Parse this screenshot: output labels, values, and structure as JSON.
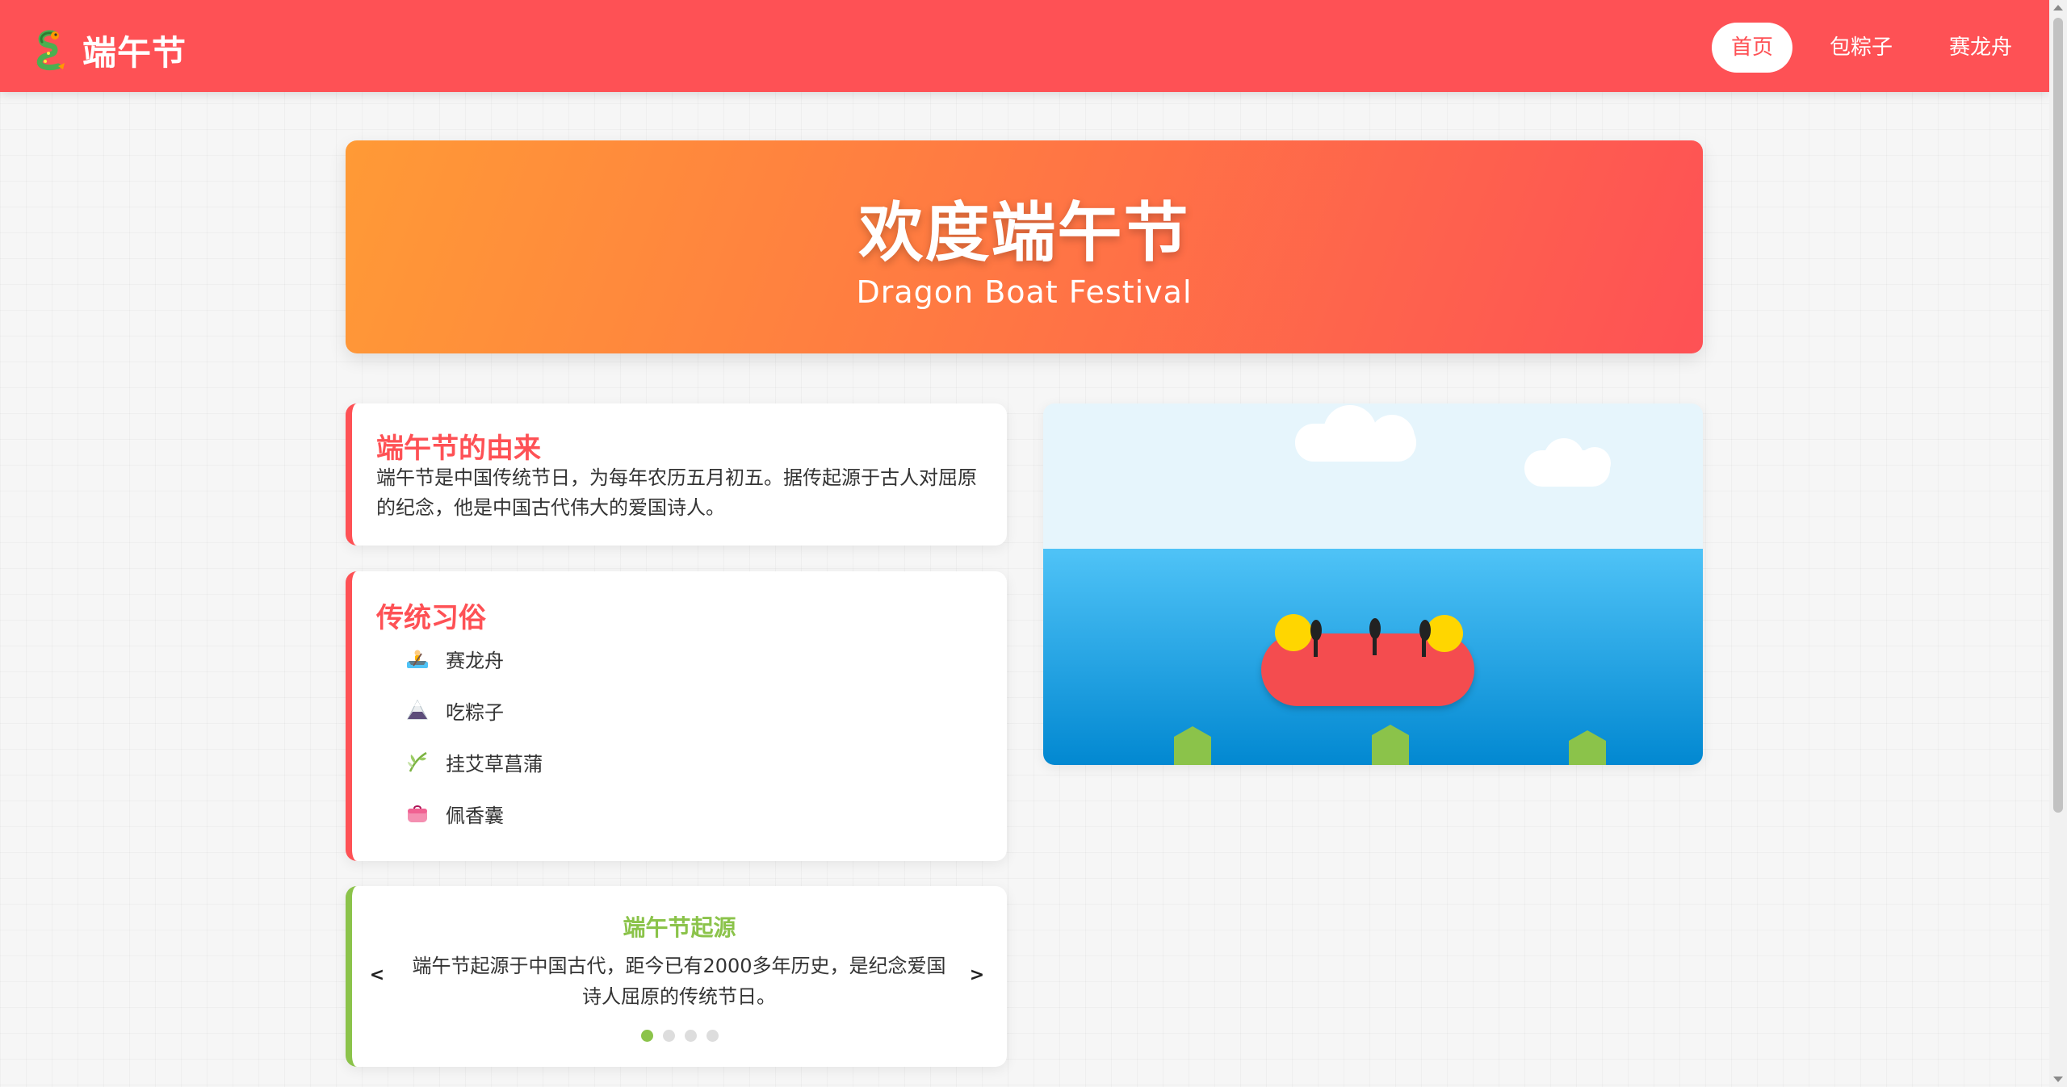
{
  "app": {
    "brand_title": "端午节",
    "brand_logo_icon": "dragon-icon"
  },
  "nav": {
    "items": [
      {
        "label": "首页",
        "active": true
      },
      {
        "label": "包粽子",
        "active": false
      },
      {
        "label": "赛龙舟",
        "active": false
      }
    ]
  },
  "hero": {
    "title": "欢度端午节",
    "subtitle": "Dragon Boat Festival"
  },
  "origin_card": {
    "title": "端午节的由来",
    "text": "端午节是中国传统节日，为每年农历五月初五。据传起源于古人对屈原的纪念，他是中国古代伟大的爱国诗人。"
  },
  "customs_card": {
    "title": "传统习俗",
    "items": [
      {
        "icon": "rowing-boat-icon",
        "label": "赛龙舟"
      },
      {
        "icon": "rice-dumpling-icon",
        "label": "吃粽子"
      },
      {
        "icon": "herb-icon",
        "label": "挂艾草菖蒲"
      },
      {
        "icon": "sachet-icon",
        "label": "佩香囊"
      }
    ]
  },
  "slider_card": {
    "title": "端午节起源",
    "text": "端午节起源于中国古代，距今已有2000多年历史，是纪念爱国诗人屈原的传统节日。",
    "prev_label": "<",
    "next_label": ">",
    "current_slide": 1,
    "total_slides": 4
  },
  "colors": {
    "primary": "#fe5155",
    "accent_green": "#8bc34a",
    "hero_gradient_start": "#ff9a36",
    "hero_gradient_end": "#fe5155",
    "sky": "#e6f5fc",
    "water_top": "#4fc3f7",
    "water_bottom": "#0288d1",
    "boat": "#f44c4f",
    "boat_head": "#ffd600"
  }
}
